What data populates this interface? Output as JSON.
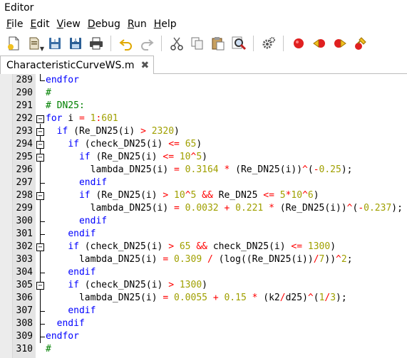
{
  "window": {
    "title": "Editor"
  },
  "menu": [
    {
      "label": "File",
      "mnemonic": "F",
      "rest": "ile"
    },
    {
      "label": "Edit",
      "mnemonic": "E",
      "rest": "dit"
    },
    {
      "label": "View",
      "mnemonic": "V",
      "rest": "iew"
    },
    {
      "label": "Debug",
      "mnemonic": "D",
      "rest": "ebug"
    },
    {
      "label": "Run",
      "mnemonic": "R",
      "rest": "un"
    },
    {
      "label": "Help",
      "mnemonic": "H",
      "rest": "elp"
    }
  ],
  "toolbar": {
    "icons": [
      "new-file-icon",
      "open-file-icon",
      "save-icon",
      "save-as-icon",
      "print-icon",
      "undo-icon",
      "redo-icon",
      "cut-icon",
      "copy-icon",
      "paste-icon",
      "find-icon",
      "settings-icon",
      "toggle-breakpoint-icon",
      "previous-breakpoint-icon",
      "next-breakpoint-icon",
      "clear-breakpoints-icon"
    ]
  },
  "tab": {
    "label": "CharacteristicCurveWS.m",
    "close": "✖"
  },
  "editor": {
    "lines": [
      {
        "n": "289",
        "tokens": [
          [
            "kw",
            "endfor"
          ]
        ]
      },
      {
        "n": "290",
        "tokens": [
          [
            "cm",
            "#"
          ]
        ]
      },
      {
        "n": "291",
        "tokens": [
          [
            "cm",
            "# DN25:"
          ]
        ]
      },
      {
        "n": "292",
        "tokens": [
          [
            "kw",
            "for"
          ],
          [
            "pl",
            " i "
          ],
          [
            "op",
            "="
          ],
          [
            "pl",
            " "
          ],
          [
            "num",
            "1"
          ],
          [
            "op",
            ":"
          ],
          [
            "num",
            "601"
          ]
        ]
      },
      {
        "n": "293",
        "tokens": [
          [
            "pl",
            "  "
          ],
          [
            "kw",
            "if"
          ],
          [
            "pl",
            " (Re_DN25(i) "
          ],
          [
            "op",
            ">"
          ],
          [
            "pl",
            " "
          ],
          [
            "num",
            "2320"
          ],
          [
            "pl",
            ")"
          ]
        ]
      },
      {
        "n": "294",
        "tokens": [
          [
            "pl",
            "    "
          ],
          [
            "kw",
            "if"
          ],
          [
            "pl",
            " (check_DN25(i) "
          ],
          [
            "op",
            "<="
          ],
          [
            "pl",
            " "
          ],
          [
            "num",
            "65"
          ],
          [
            "pl",
            ")"
          ]
        ]
      },
      {
        "n": "295",
        "tokens": [
          [
            "pl",
            "      "
          ],
          [
            "kw",
            "if"
          ],
          [
            "pl",
            " (Re_DN25(i) "
          ],
          [
            "op",
            "<="
          ],
          [
            "pl",
            " "
          ],
          [
            "num",
            "10"
          ],
          [
            "op",
            "^"
          ],
          [
            "num",
            "5"
          ],
          [
            "pl",
            ")"
          ]
        ]
      },
      {
        "n": "296",
        "tokens": [
          [
            "pl",
            "        lambda_DN25(i) "
          ],
          [
            "op",
            "="
          ],
          [
            "pl",
            " "
          ],
          [
            "num",
            "0.3164"
          ],
          [
            "pl",
            " "
          ],
          [
            "op",
            "*"
          ],
          [
            "pl",
            " (Re_DN25(i))"
          ],
          [
            "op",
            "^"
          ],
          [
            "pl",
            "("
          ],
          [
            "op",
            "-"
          ],
          [
            "num",
            "0.25"
          ],
          [
            "pl",
            ");"
          ]
        ]
      },
      {
        "n": "297",
        "tokens": [
          [
            "pl",
            "      "
          ],
          [
            "kw",
            "endif"
          ]
        ]
      },
      {
        "n": "298",
        "tokens": [
          [
            "pl",
            "      "
          ],
          [
            "kw",
            "if"
          ],
          [
            "pl",
            " (Re_DN25(i) "
          ],
          [
            "op",
            ">"
          ],
          [
            "pl",
            " "
          ],
          [
            "num",
            "10"
          ],
          [
            "op",
            "^"
          ],
          [
            "num",
            "5"
          ],
          [
            "pl",
            " "
          ],
          [
            "op",
            "&&"
          ],
          [
            "pl",
            " Re_DN25 "
          ],
          [
            "op",
            "<="
          ],
          [
            "pl",
            " "
          ],
          [
            "num",
            "5"
          ],
          [
            "op",
            "*"
          ],
          [
            "num",
            "10"
          ],
          [
            "op",
            "^"
          ],
          [
            "num",
            "6"
          ],
          [
            "pl",
            ")"
          ]
        ]
      },
      {
        "n": "299",
        "tokens": [
          [
            "pl",
            "        lambda_DN25(i) "
          ],
          [
            "op",
            "="
          ],
          [
            "pl",
            " "
          ],
          [
            "num",
            "0.0032"
          ],
          [
            "pl",
            " "
          ],
          [
            "op",
            "+"
          ],
          [
            "pl",
            " "
          ],
          [
            "num",
            "0.221"
          ],
          [
            "pl",
            " "
          ],
          [
            "op",
            "*"
          ],
          [
            "pl",
            " (Re_DN25(i))"
          ],
          [
            "op",
            "^"
          ],
          [
            "pl",
            "("
          ],
          [
            "op",
            "-"
          ],
          [
            "num",
            "0.237"
          ],
          [
            "pl",
            ");"
          ]
        ]
      },
      {
        "n": "300",
        "tokens": [
          [
            "pl",
            "      "
          ],
          [
            "kw",
            "endif"
          ]
        ]
      },
      {
        "n": "301",
        "tokens": [
          [
            "pl",
            "    "
          ],
          [
            "kw",
            "endif"
          ]
        ]
      },
      {
        "n": "302",
        "tokens": [
          [
            "pl",
            "    "
          ],
          [
            "kw",
            "if"
          ],
          [
            "pl",
            " (check_DN25(i) "
          ],
          [
            "op",
            ">"
          ],
          [
            "pl",
            " "
          ],
          [
            "num",
            "65"
          ],
          [
            "pl",
            " "
          ],
          [
            "op",
            "&&"
          ],
          [
            "pl",
            " check_DN25(i) "
          ],
          [
            "op",
            "<="
          ],
          [
            "pl",
            " "
          ],
          [
            "num",
            "1300"
          ],
          [
            "pl",
            ")"
          ]
        ]
      },
      {
        "n": "303",
        "tokens": [
          [
            "pl",
            "      lambda_DN25(i) "
          ],
          [
            "op",
            "="
          ],
          [
            "pl",
            " "
          ],
          [
            "num",
            "0.309"
          ],
          [
            "pl",
            " "
          ],
          [
            "op",
            "/"
          ],
          [
            "pl",
            " (log((Re_DN25(i))"
          ],
          [
            "op",
            "/"
          ],
          [
            "num",
            "7"
          ],
          [
            "pl",
            "))"
          ],
          [
            "op",
            "^"
          ],
          [
            "num",
            "2"
          ],
          [
            "pl",
            ";"
          ]
        ]
      },
      {
        "n": "304",
        "tokens": [
          [
            "pl",
            "    "
          ],
          [
            "kw",
            "endif"
          ]
        ]
      },
      {
        "n": "305",
        "tokens": [
          [
            "pl",
            "    "
          ],
          [
            "kw",
            "if"
          ],
          [
            "pl",
            " (check_DN25(i) "
          ],
          [
            "op",
            ">"
          ],
          [
            "pl",
            " "
          ],
          [
            "num",
            "1300"
          ],
          [
            "pl",
            ")"
          ]
        ]
      },
      {
        "n": "306",
        "tokens": [
          [
            "pl",
            "      lambda_DN25(i) "
          ],
          [
            "op",
            "="
          ],
          [
            "pl",
            " "
          ],
          [
            "num",
            "0.0055"
          ],
          [
            "pl",
            " "
          ],
          [
            "op",
            "+"
          ],
          [
            "pl",
            " "
          ],
          [
            "num",
            "0.15"
          ],
          [
            "pl",
            " "
          ],
          [
            "op",
            "*"
          ],
          [
            "pl",
            " (k2"
          ],
          [
            "op",
            "/"
          ],
          [
            "pl",
            "d25)"
          ],
          [
            "op",
            "^"
          ],
          [
            "pl",
            "("
          ],
          [
            "num",
            "1"
          ],
          [
            "op",
            "/"
          ],
          [
            "num",
            "3"
          ],
          [
            "pl",
            ");"
          ]
        ]
      },
      {
        "n": "307",
        "tokens": [
          [
            "pl",
            "    "
          ],
          [
            "kw",
            "endif"
          ]
        ]
      },
      {
        "n": "308",
        "tokens": [
          [
            "pl",
            "  "
          ],
          [
            "kw",
            "endif"
          ]
        ]
      },
      {
        "n": "309",
        "tokens": [
          [
            "kw",
            "endfor"
          ]
        ]
      },
      {
        "n": "310",
        "tokens": [
          [
            "cm",
            "#"
          ]
        ]
      }
    ]
  }
}
